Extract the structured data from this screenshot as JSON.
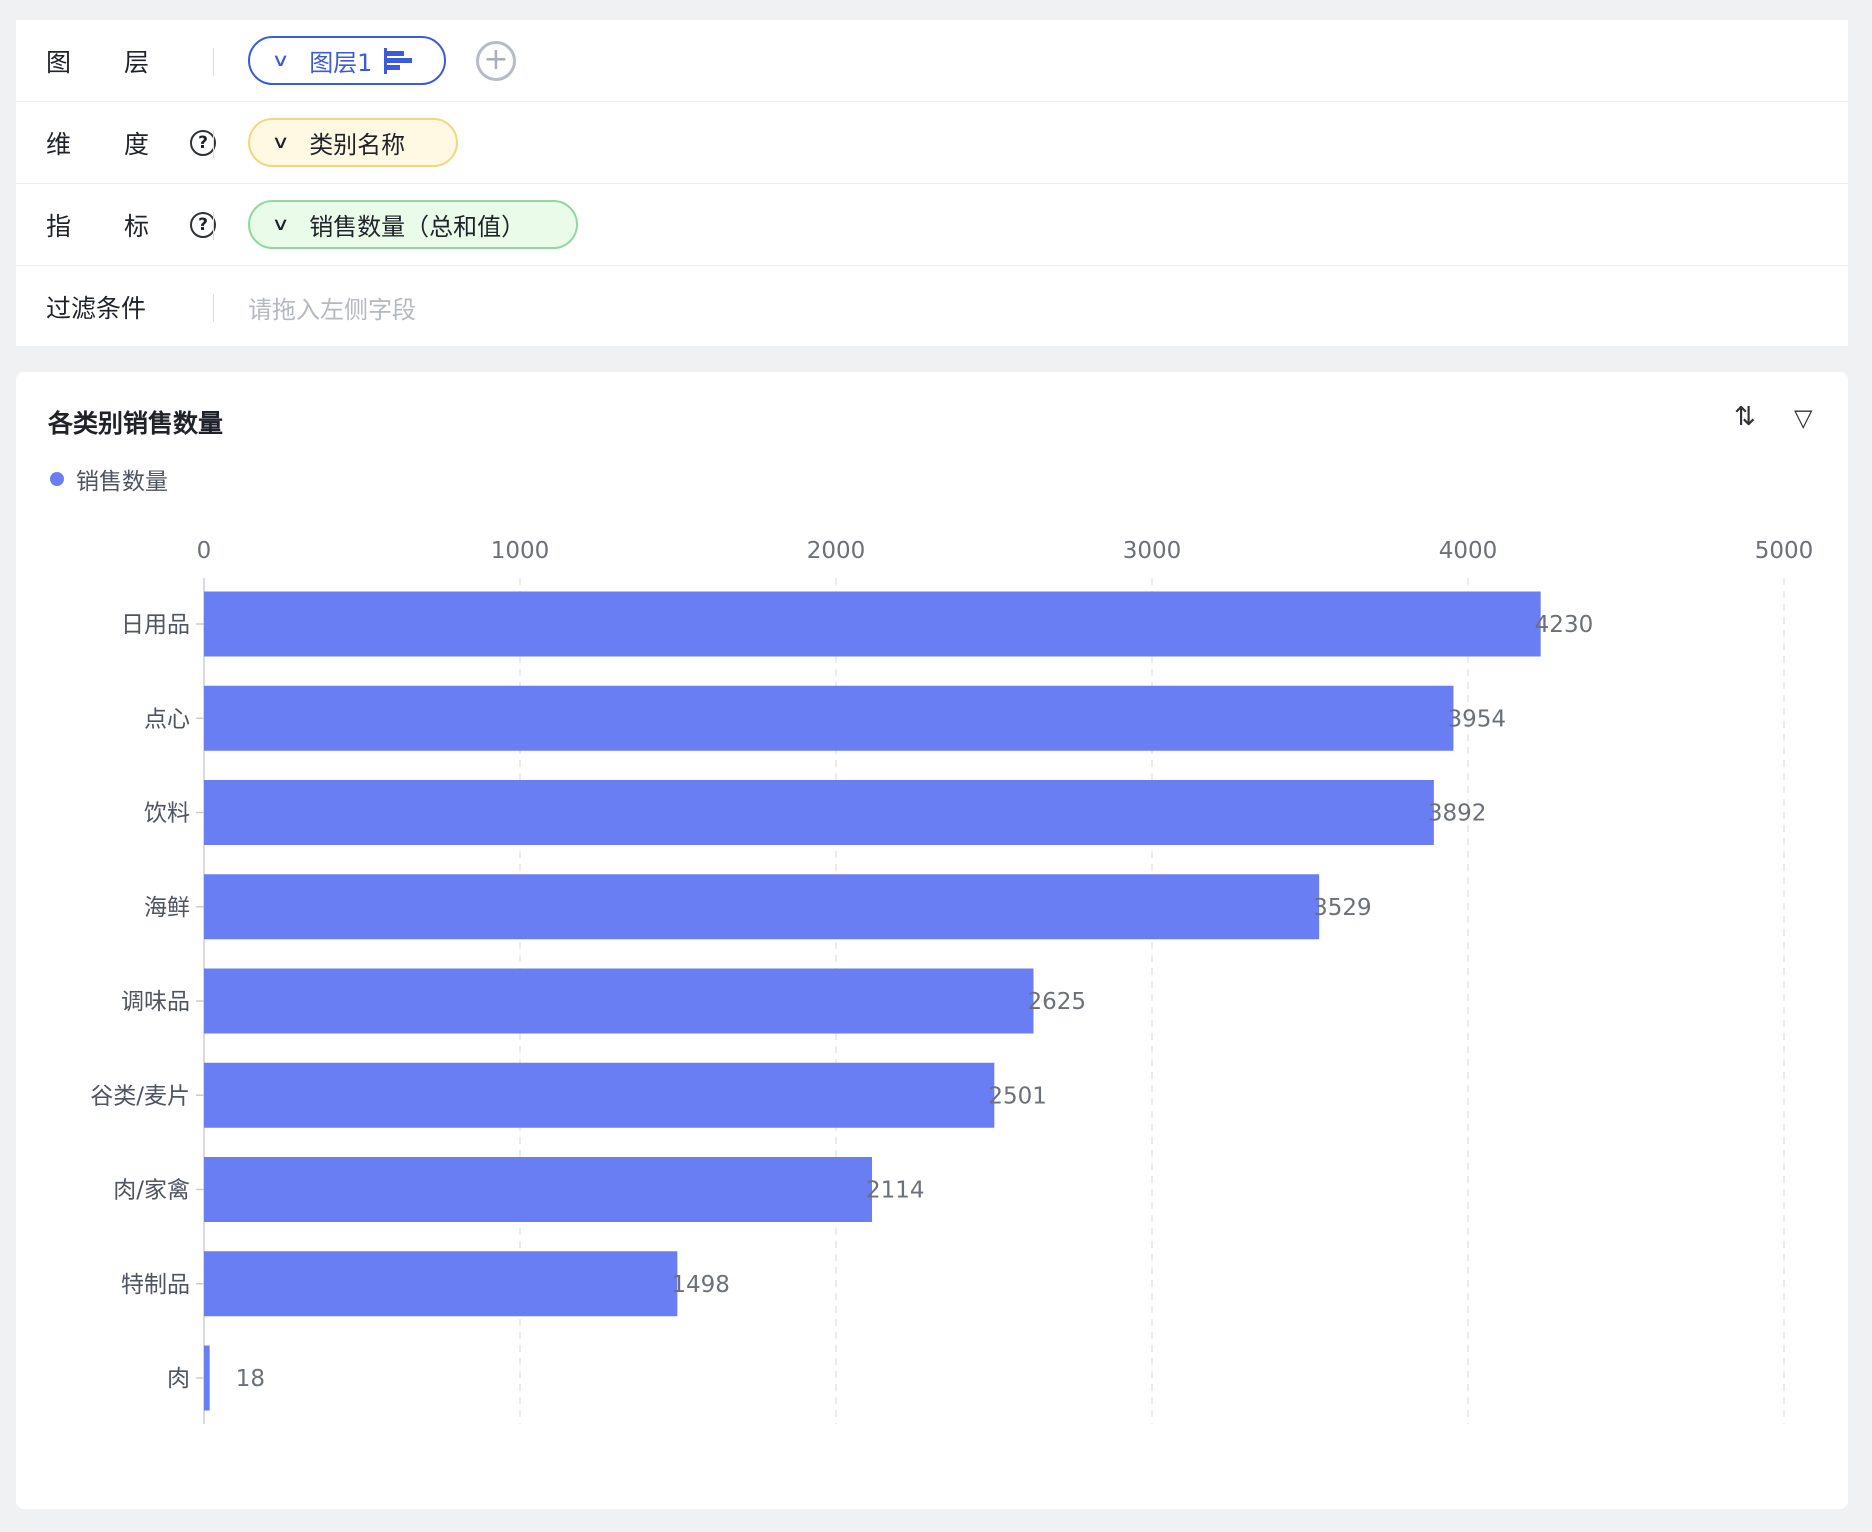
{
  "config": {
    "layer": {
      "label_a": "图",
      "label_b": "层",
      "pill_text": "图层1"
    },
    "dimension": {
      "label_a": "维",
      "label_b": "度",
      "pill_text": "类别名称"
    },
    "metric": {
      "label_a": "指",
      "label_b": "标",
      "pill_text": "销售数量（总和值）"
    },
    "filter": {
      "label": "过滤条件",
      "placeholder": "请拖入左侧字段"
    }
  },
  "colors": {
    "bar": "#6a7ef3",
    "accent": "#3b5bdb"
  },
  "icons": {
    "chevron": "chevron-down-icon",
    "help": "help-circle-icon",
    "add": "plus-circle-icon",
    "sort": "sort-icon",
    "filter": "filter-icon"
  },
  "chart_data": {
    "type": "bar",
    "orientation": "horizontal",
    "title": "各类别销售数量",
    "categories": [
      "日用品",
      "点心",
      "饮料",
      "海鲜",
      "调味品",
      "谷类/麦片",
      "肉/家禽",
      "特制品",
      "肉"
    ],
    "series": [
      {
        "name": "销售数量",
        "values": [
          4230,
          3954,
          3892,
          3529,
          2625,
          2501,
          2114,
          1498,
          18
        ]
      }
    ],
    "xlim": [
      0,
      5000
    ],
    "xticks": [
      0,
      1000,
      2000,
      3000,
      4000,
      5000
    ],
    "xaxis_position": "top",
    "grid": "vertical dashed",
    "legend_position": "top-left",
    "data_labels": true
  }
}
